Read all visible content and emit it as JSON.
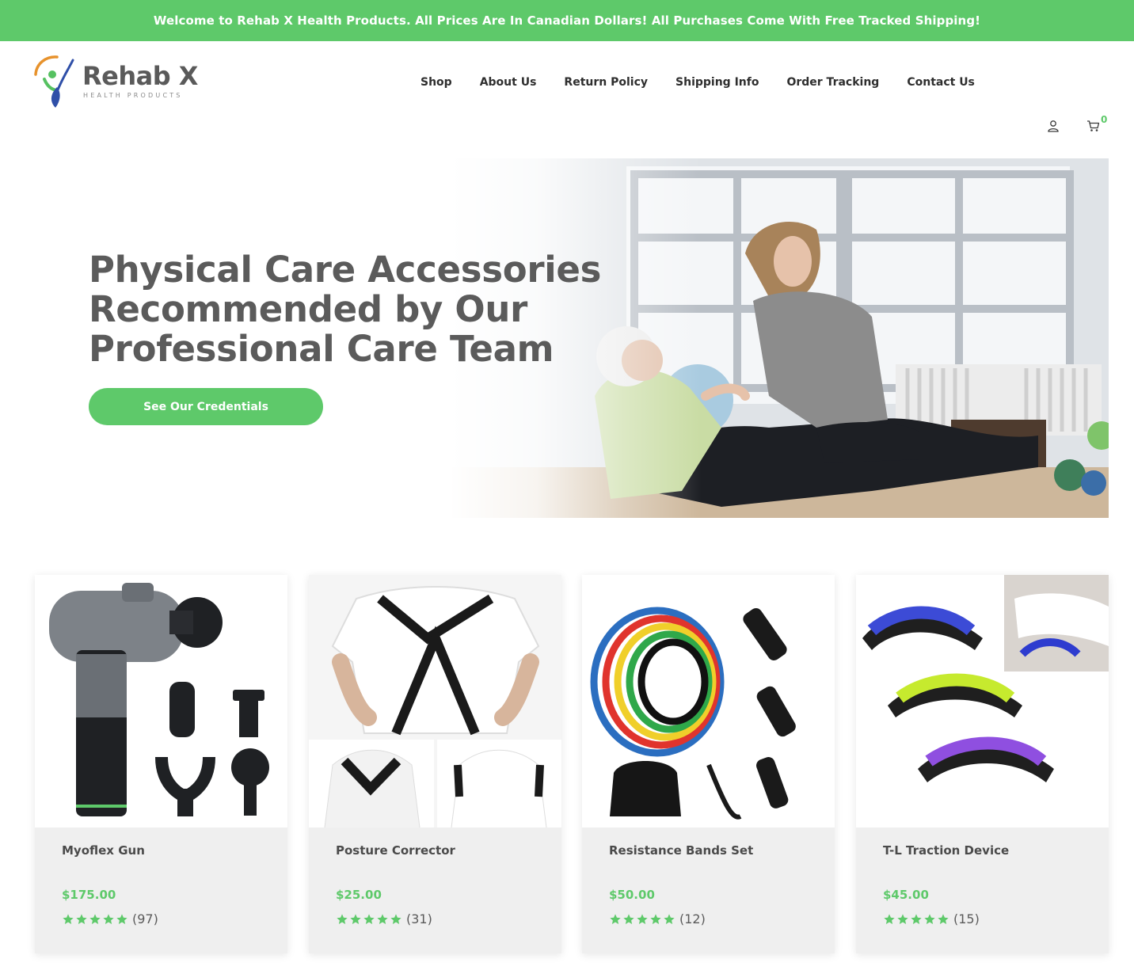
{
  "announcement": "Welcome to Rehab X Health Products. All Prices Are In Canadian Dollars! All Purchases Come With Free Tracked Shipping!",
  "brand": {
    "name": "Rehab X",
    "tagline": "HEALTH PRODUCTS"
  },
  "nav": {
    "items": [
      "Shop",
      "About Us",
      "Return Policy",
      "Shipping Info",
      "Order Tracking",
      "Contact Us"
    ]
  },
  "header_icons": {
    "account_icon": "user-icon",
    "cart_icon": "cart-icon",
    "cart_count": "0"
  },
  "hero": {
    "title_lines": [
      "Physical Care Accessories",
      "Recommended by Our",
      "Professional Care Team"
    ],
    "cta_label": "See Our Credentials"
  },
  "products": [
    {
      "name": "Myoflex Gun",
      "price": "$175.00",
      "rating": 5,
      "rating_max": 5,
      "reviews": "(97)"
    },
    {
      "name": "Posture Corrector",
      "price": "$25.00",
      "rating": 5,
      "rating_max": 5,
      "reviews": "(31)"
    },
    {
      "name": "Resistance Bands Set",
      "price": "$50.00",
      "rating": 5,
      "rating_max": 5,
      "reviews": "(12)"
    },
    {
      "name": "T-L Traction Device",
      "price": "$45.00",
      "rating": 5,
      "rating_max": 5,
      "reviews": "(15)"
    }
  ],
  "colors": {
    "accent": "#5ec96a",
    "text": "#3a3a3a",
    "card_info_bg": "#efefef",
    "logo_blue": "#2f4fa8",
    "logo_orange": "#e7922c",
    "logo_green": "#56c161"
  }
}
